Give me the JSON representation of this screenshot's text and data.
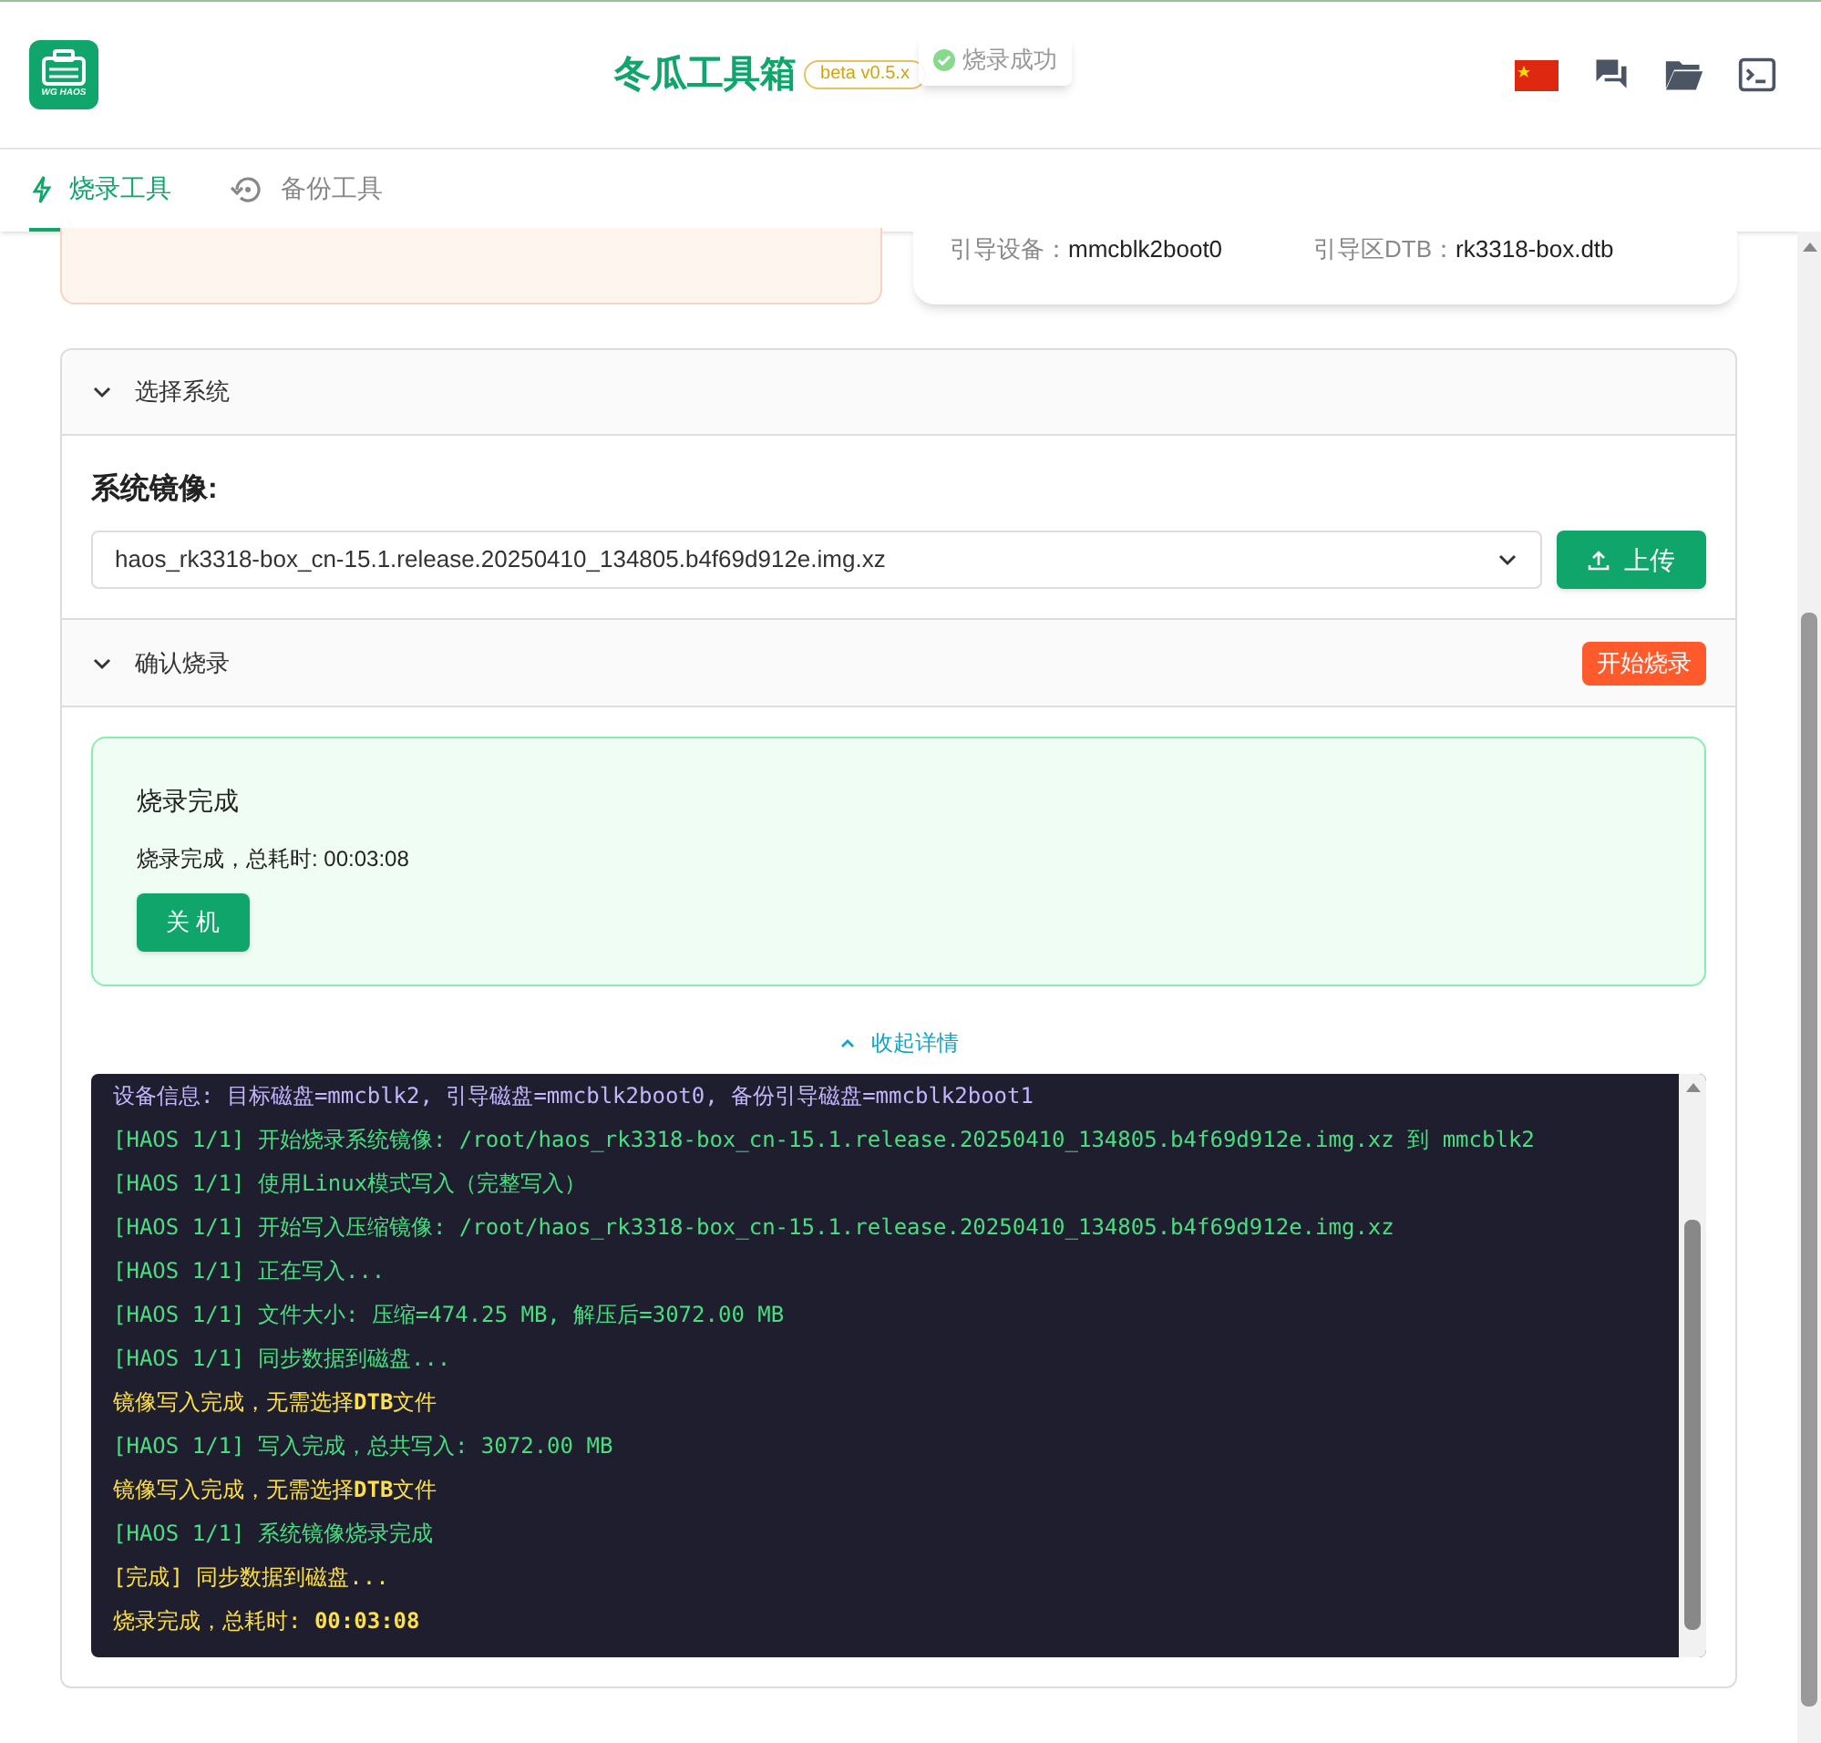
{
  "header": {
    "logo_text": "WG HAOS",
    "title": "冬瓜工具箱",
    "version": "beta v0.5.x",
    "toast": "烧录成功"
  },
  "tabs": [
    {
      "label": "烧录工具",
      "selected": true,
      "kind": "flash"
    },
    {
      "label": "备份工具",
      "selected": false,
      "kind": "backup"
    }
  ],
  "device_info": [
    {
      "label": "引导设备：",
      "value": "mmcblk2boot0"
    },
    {
      "label": "引导区DTB：",
      "value": "rk3318-box.dtb"
    }
  ],
  "select_section": {
    "title": "选择系统",
    "expanded": true,
    "image_label": "系统镜像:",
    "image_value": "haos_rk3318-box_cn-15.1.release.20250410_134805.b4f69d912e.img.xz",
    "upload_button": "上传"
  },
  "confirm_section": {
    "title": "确认烧录",
    "expanded": true,
    "start_button": "开始烧录"
  },
  "result": {
    "title": "烧录完成",
    "message": "烧录完成，总耗时: 00:03:08",
    "shutdown_button": "关 机"
  },
  "details_toggle": {
    "label": "收起详情",
    "expanded": true
  },
  "log": [
    {
      "kind": "device",
      "text": "设备信息: 目标磁盘=mmcblk2, 引导磁盘=mmcblk2boot0, 备份引导磁盘=mmcblk2boot1"
    },
    {
      "kind": "step",
      "text": "[HAOS 1/1] 开始烧录系统镜像: /root/haos_rk3318-box_cn-15.1.release.20250410_134805.b4f69d912e.img.xz 到 mmcblk2"
    },
    {
      "kind": "step",
      "text": "[HAOS 1/1] 使用Linux模式写入（完整写入）"
    },
    {
      "kind": "step",
      "text": "[HAOS 1/1] 开始写入压缩镜像: /root/haos_rk3318-box_cn-15.1.release.20250410_134805.b4f69d912e.img.xz"
    },
    {
      "kind": "step",
      "text": "[HAOS 1/1] 正在写入..."
    },
    {
      "kind": "step",
      "text": "[HAOS 1/1] 文件大小: 压缩=474.25 MB, 解压后=3072.00 MB"
    },
    {
      "kind": "step",
      "text": "[HAOS 1/1] 同步数据到磁盘..."
    },
    {
      "kind": "notice",
      "text": "镜像写入完成，无需选择**DTB**文件"
    },
    {
      "kind": "step",
      "text": "[HAOS 1/1] 写入完成，总共写入: 3072.00 MB"
    },
    {
      "kind": "notice",
      "text": "镜像写入完成，无需选择**DTB**文件"
    },
    {
      "kind": "step",
      "text": "[HAOS 1/1] 系统镜像烧录完成"
    },
    {
      "kind": "notice",
      "text": "[完成] 同步数据到磁盘..."
    },
    {
      "kind": "notice",
      "text": "烧录完成，总耗时: **00:03:08**"
    }
  ]
}
